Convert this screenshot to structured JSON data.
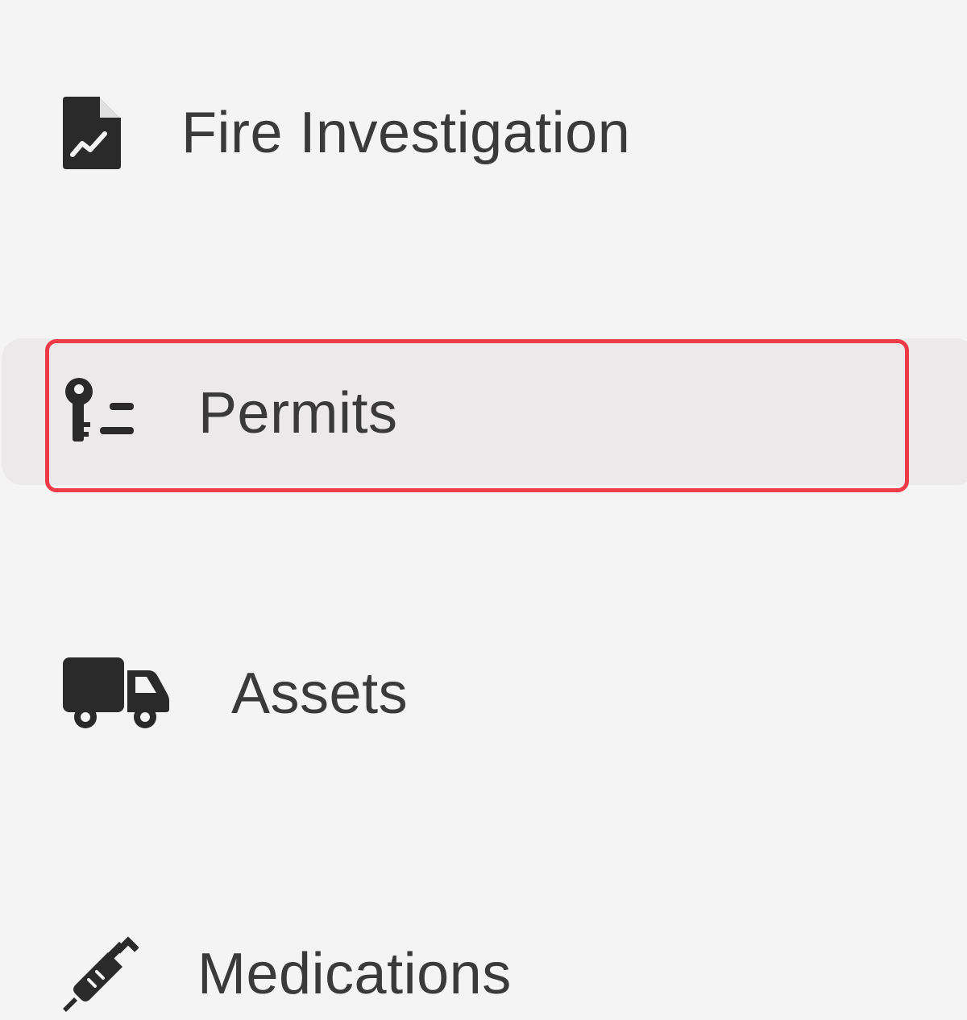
{
  "nav": {
    "items": [
      {
        "label": "Fire Investigation",
        "icon": "file-chart-icon"
      },
      {
        "label": "Permits",
        "icon": "key-list-icon",
        "active": true
      },
      {
        "label": "Assets",
        "icon": "truck-icon"
      },
      {
        "label": "Medications",
        "icon": "syringe-icon"
      }
    ]
  },
  "colors": {
    "background": "#f4f4f4",
    "active_background": "#ebe9ea",
    "highlight_border": "#ef3a48",
    "text": "#3a3a3a",
    "icon": "#2a2a2a"
  }
}
